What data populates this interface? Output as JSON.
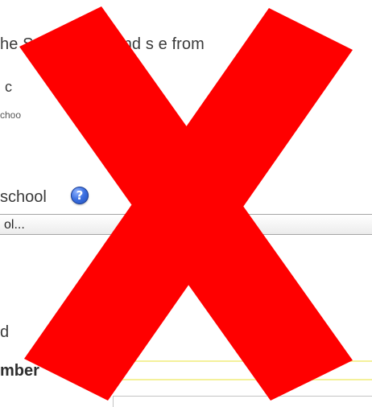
{
  "form": {
    "instruction": "he Sch     d name and s           e from",
    "board_label_partial": "c",
    "board_hint_partial": "choo",
    "school_label": "school",
    "school_help_icon": "question-mark-icon",
    "school_select_value": "ol...",
    "field_label_a_partial": "d",
    "field_label_b_partial": "mber"
  },
  "overlay": {
    "icon": "x-mark-icon",
    "color": "#ff0000"
  },
  "colors": {
    "page_background": "#ffffff",
    "help_icon": "#3b6fe0",
    "field_highlight": "#f4f19a"
  }
}
